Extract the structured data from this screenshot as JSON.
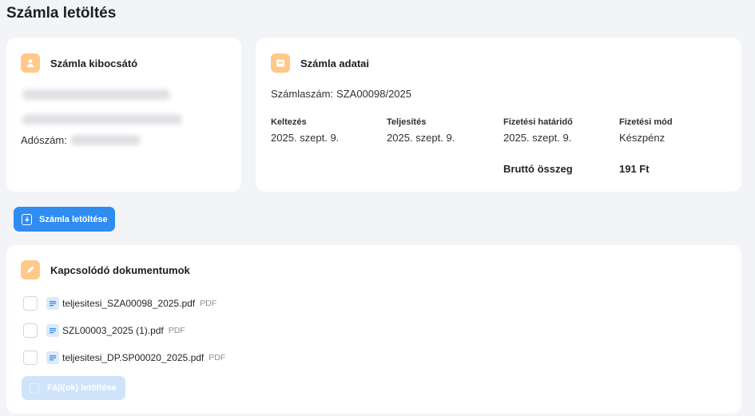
{
  "page": {
    "title": "Számla letöltés"
  },
  "issuer": {
    "title": "Számla kibocsátó",
    "tax_label": "Adószám:",
    "icon": "user-icon"
  },
  "invoice": {
    "title": "Számla adatai",
    "number_label": "Számlaszám:",
    "number": "SZA00098/2025",
    "fields": [
      {
        "label": "Keltezés",
        "value": "2025. szept. 9."
      },
      {
        "label": "Teljesítés",
        "value": "2025. szept. 9."
      },
      {
        "label": "Fizetési határidő",
        "value": "2025. szept. 9."
      },
      {
        "label": "Fizetési mód",
        "value": "Készpénz"
      }
    ],
    "gross_label": "Bruttó összeg",
    "gross_value": "191 Ft"
  },
  "download_button": {
    "label": "Számla letöltése",
    "icon": "download-icon"
  },
  "related": {
    "title": "Kapcsolódó dokumentumok",
    "files": [
      {
        "name": "teljesitesi_SZA00098_2025.pdf",
        "type": "PDF"
      },
      {
        "name": "SZL00003_2025 (1).pdf",
        "type": "PDF"
      },
      {
        "name": "teljesitesi_DP.SP00020_2025.pdf",
        "type": "PDF"
      }
    ],
    "download_files_label": "Fájl(ok) letöltése"
  },
  "colors": {
    "accent": "#2f8cf0",
    "icon_bg": "#ffc98a",
    "background": "#f2f4f7"
  }
}
